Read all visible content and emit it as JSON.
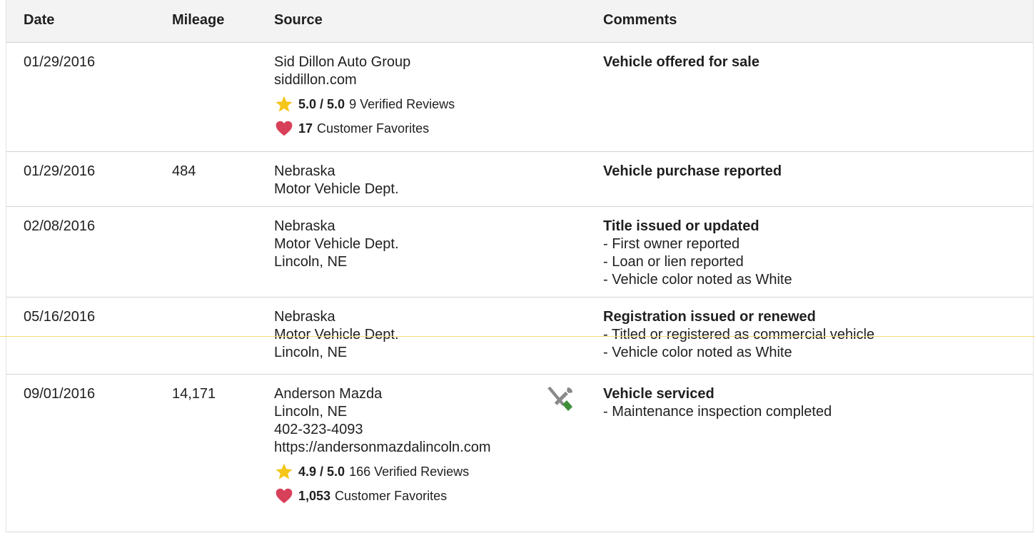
{
  "columns": {
    "date": "Date",
    "mileage": "Mileage",
    "source": "Source",
    "comments": "Comments"
  },
  "rows": [
    {
      "date": "01/29/2016",
      "mileage": "",
      "source": [
        "Sid Dillon Auto Group",
        "siddillon.com"
      ],
      "rating": {
        "score": "5.0 / 5.0",
        "reviews": "9 Verified Reviews",
        "icon": "star-icon"
      },
      "favorites": {
        "count": "17",
        "label": "Customer Favorites",
        "icon": "heart-icon"
      },
      "comment_title": "Vehicle offered for sale",
      "comment_items": []
    },
    {
      "date": "01/29/2016",
      "mileage": "484",
      "source": [
        "Nebraska",
        "Motor Vehicle Dept."
      ],
      "comment_title": "Vehicle purchase reported",
      "comment_items": []
    },
    {
      "date": "02/08/2016",
      "mileage": "",
      "source": [
        "Nebraska",
        "Motor Vehicle Dept.",
        "Lincoln, NE"
      ],
      "comment_title": "Title issued or updated",
      "comment_items": [
        "- First owner reported",
        "- Loan or lien reported",
        "- Vehicle color noted as White"
      ]
    },
    {
      "date": "05/16/2016",
      "mileage": "",
      "source": [
        "Nebraska",
        "Motor Vehicle Dept.",
        "Lincoln, NE"
      ],
      "comment_title": "Registration issued or renewed",
      "comment_items": [
        "- Titled or registered as commercial vehicle",
        "- Vehicle color noted as White"
      ]
    },
    {
      "date": "09/01/2016",
      "mileage": "14,171",
      "source": [
        "Anderson Mazda",
        "Lincoln, NE",
        "402-323-4093"
      ],
      "source_url": "https://andersonmazdalincoln.com",
      "rating": {
        "score": "4.9 / 5.0",
        "reviews": "166 Verified Reviews",
        "icon": "star-icon"
      },
      "favorites": {
        "count": "1,053",
        "label": "Customer Favorites",
        "icon": "heart-icon"
      },
      "service_icon": "wrench-screwdriver-icon",
      "comment_title": "Vehicle serviced",
      "comment_items": [
        "- Maintenance inspection completed"
      ]
    }
  ],
  "colors": {
    "star": "#f5c518",
    "heart": "#d8405a",
    "tool_gray": "#8a8a8a",
    "tool_green": "#3f8e3a"
  }
}
